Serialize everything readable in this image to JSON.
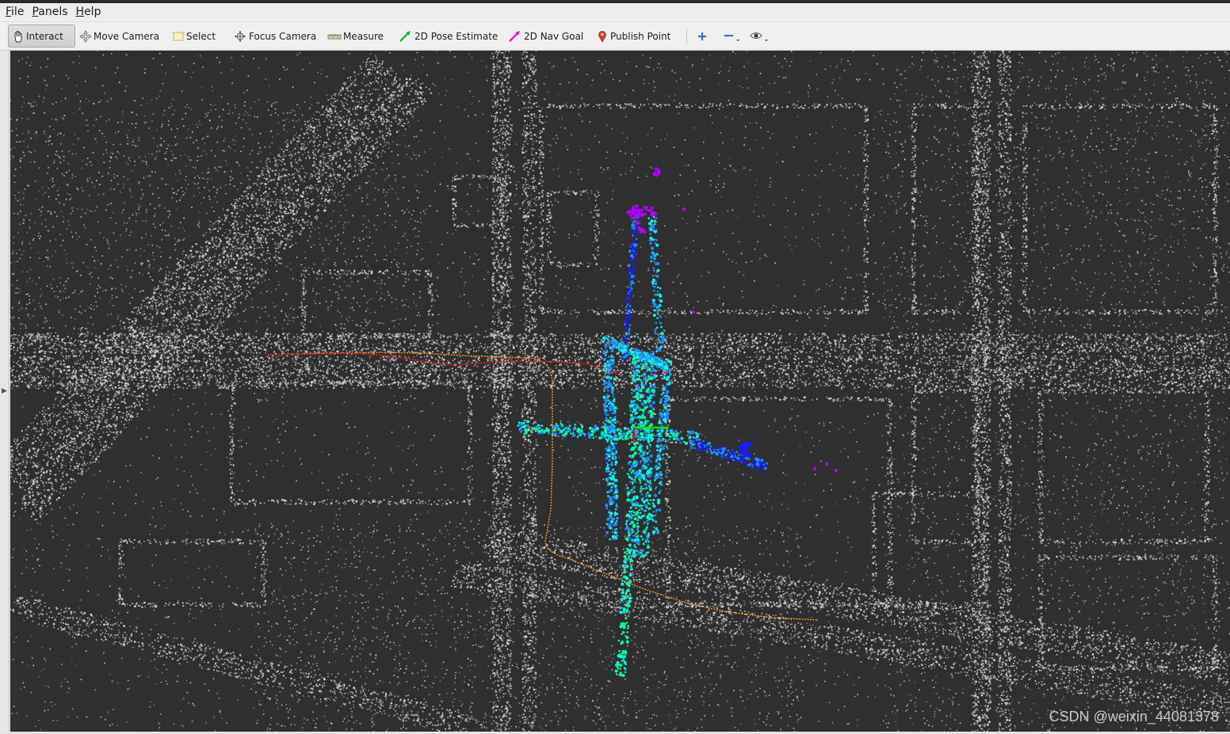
{
  "menubar": {
    "file": {
      "accel": "F",
      "rest": "ile"
    },
    "panels": {
      "accel": "P",
      "rest": "anels"
    },
    "help": {
      "accel": "H",
      "rest": "elp"
    }
  },
  "toolbar": {
    "interact": "Interact",
    "move_camera": "Move Camera",
    "select": "Select",
    "focus_camera": "Focus Camera",
    "measure": "Measure",
    "pose_estimate": "2D Pose Estimate",
    "nav_goal": "2D Nav Goal",
    "publish_point": "Publish Point",
    "icons": [
      "plus-icon",
      "minus-icon",
      "eye-icon"
    ]
  },
  "viewport": {
    "background": "#2f2f2f",
    "map_point_color": "#d8d8d8",
    "scan_colors": [
      "#1a1aff",
      "#1e8cff",
      "#14f0e6",
      "#00ff96",
      "#b400ff"
    ],
    "path_colors": {
      "odometry": "#ff9f1a",
      "recent": "#ff2020"
    }
  },
  "watermark": "CSDN @weixin_44081378"
}
